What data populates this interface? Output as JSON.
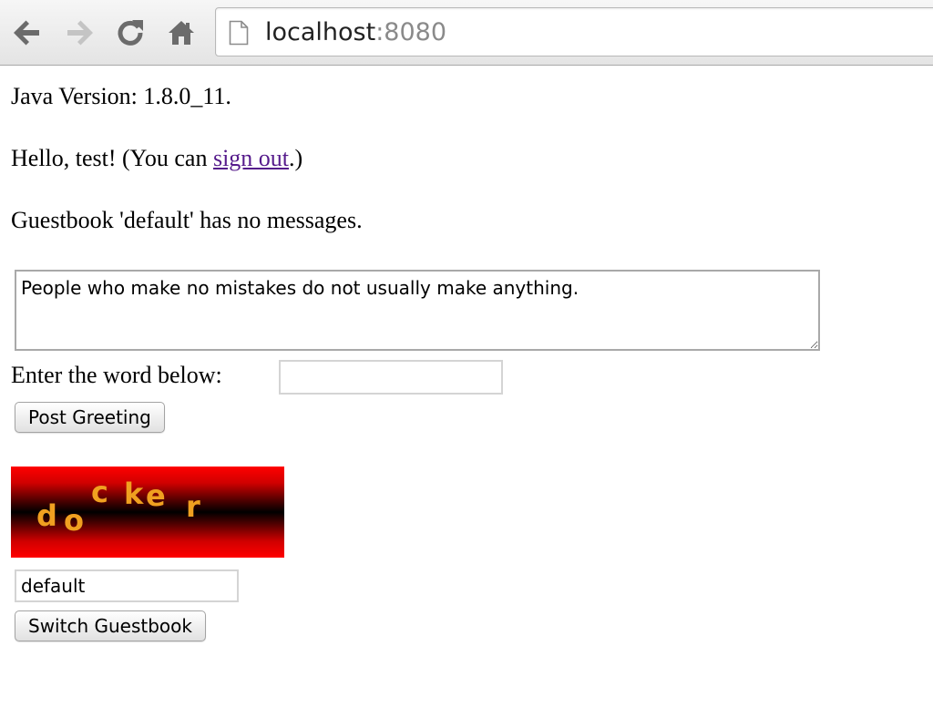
{
  "browser": {
    "url_host": "localhost",
    "url_port": ":8080",
    "icons": {
      "back": "back-arrow-icon",
      "forward": "forward-arrow-icon",
      "reload": "reload-icon",
      "home": "home-icon",
      "page": "page-icon"
    }
  },
  "page": {
    "java_version": "Java Version: 1.8.0_11.",
    "hello_prefix": "Hello, test! (You can ",
    "signout_label": "sign out",
    "hello_suffix": ".)",
    "guestbook_status": "Guestbook 'default' has no messages.",
    "greeting_text": "People who make no mistakes do not usually make anything.",
    "captcha_prompt": "Enter the word below:",
    "captcha_input_value": "",
    "post_button_label": "Post Greeting",
    "captcha_chars": [
      "d",
      "o",
      "c",
      "k",
      "e",
      "r"
    ],
    "guestbook_name_value": "default",
    "switch_button_label": "Switch Guestbook"
  },
  "colors": {
    "link_visited": "#551a8b",
    "captcha_text": "#f0a020",
    "captcha_edge": "#ff0000",
    "captcha_center": "#000000"
  }
}
